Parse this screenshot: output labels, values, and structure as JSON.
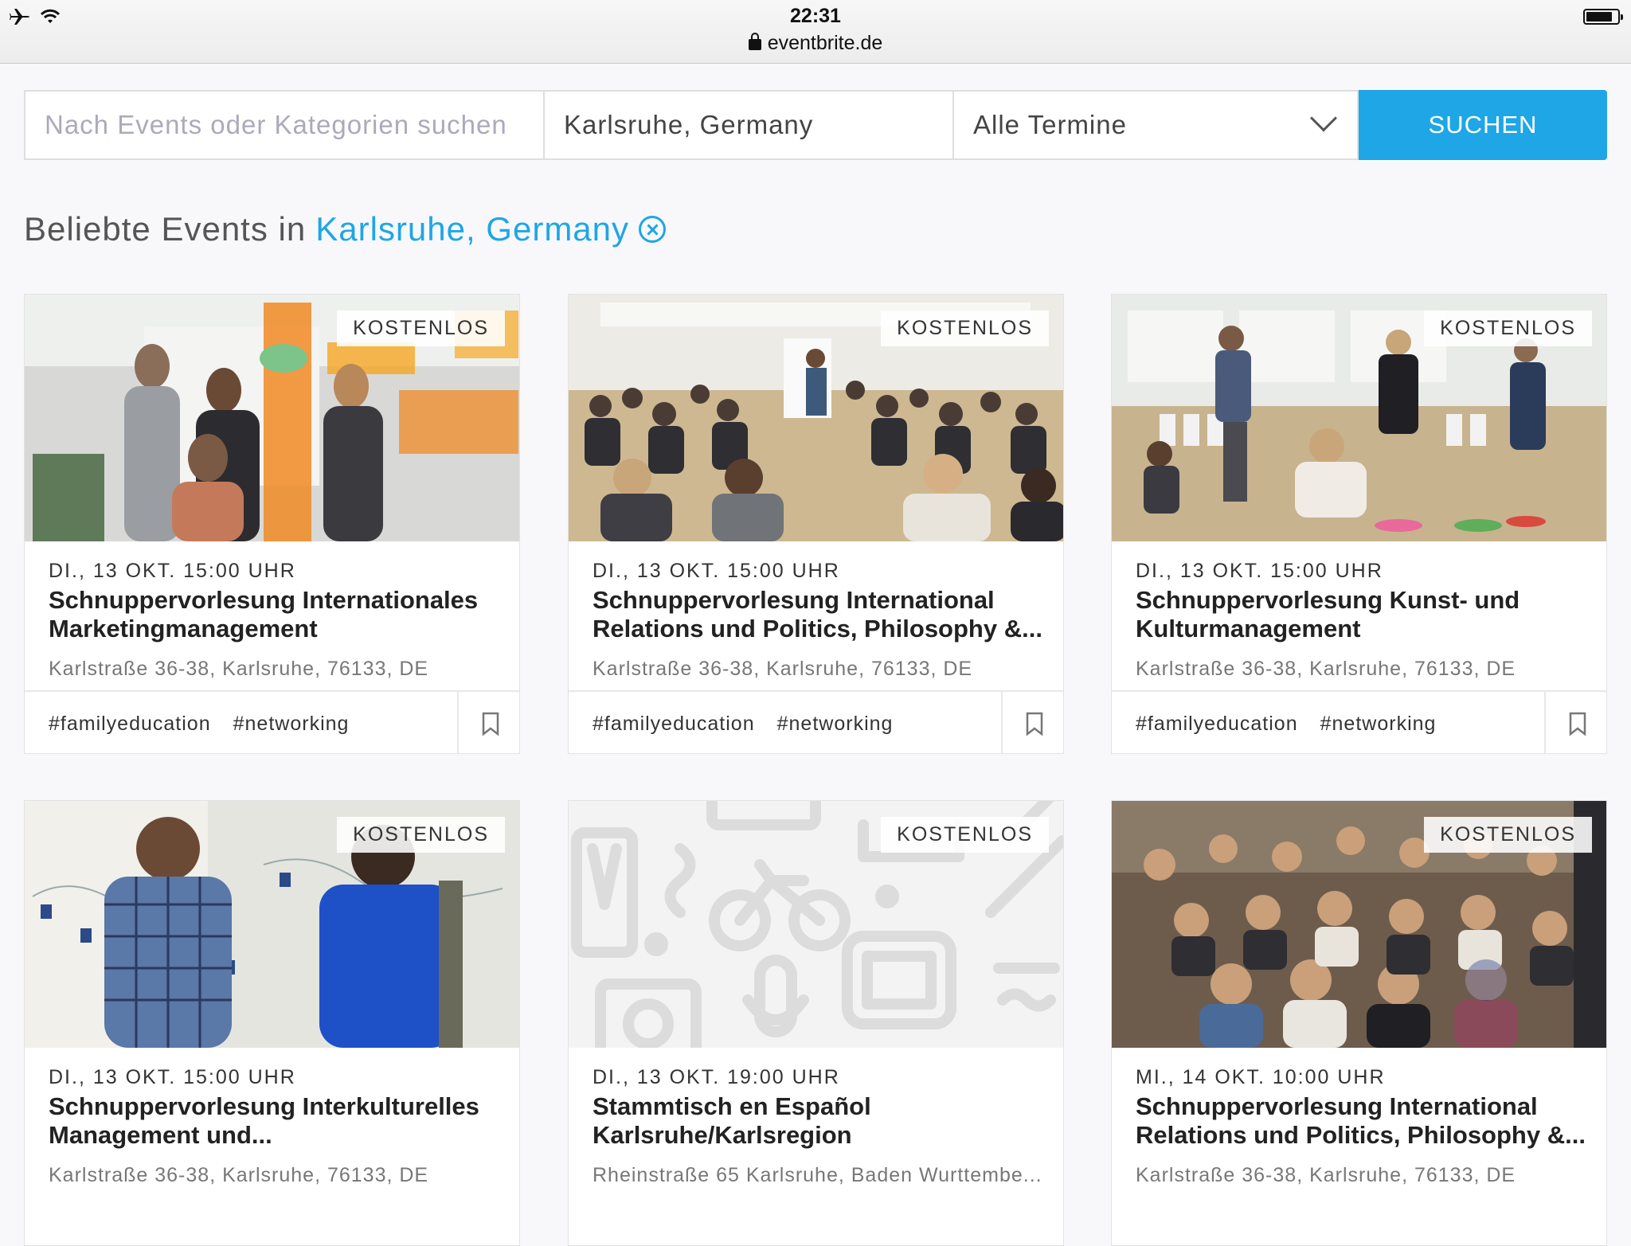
{
  "status": {
    "time": "22:31",
    "url": "eventbrite.de",
    "battery_level": 0.85
  },
  "search": {
    "query_placeholder": "Nach Events oder Kategorien suchen",
    "location": "Karlsruhe, Germany",
    "date": "Alle Termine",
    "button": "SUCHEN"
  },
  "heading": {
    "prefix": "Beliebte Events in",
    "city": "Karlsruhe, Germany"
  },
  "cards": [
    {
      "badge": "KOSTENLOS",
      "date": "DI., 13 OKT. 15:00 UHR",
      "title": "Schnuppervorlesung Internationales Marketingmanagement",
      "address": "Karlstraße 36-38, Karlsruhe, 76133, DE",
      "tags": [
        "#familyeducation",
        "#networking"
      ]
    },
    {
      "badge": "KOSTENLOS",
      "date": "DI., 13 OKT. 15:00 UHR",
      "title": "Schnuppervorlesung International Relations und Politics, Philosophy &...",
      "address": "Karlstraße 36-38, Karlsruhe, 76133, DE",
      "tags": [
        "#familyeducation",
        "#networking"
      ]
    },
    {
      "badge": "KOSTENLOS",
      "date": "DI., 13 OKT. 15:00 UHR",
      "title": "Schnuppervorlesung Kunst- und Kulturmanagement",
      "address": "Karlstraße 36-38, Karlsruhe, 76133, DE",
      "tags": [
        "#familyeducation",
        "#networking"
      ]
    },
    {
      "badge": "KOSTENLOS",
      "date": "DI., 13 OKT. 15:00 UHR",
      "title": "Schnuppervorlesung Interkulturelles Management und...",
      "address": "Karlstraße 36-38, Karlsruhe, 76133, DE",
      "tags": []
    },
    {
      "badge": "KOSTENLOS",
      "date": "DI., 13 OKT. 19:00 UHR",
      "title": "Stammtisch en Español Karlsruhe/Karlsregion",
      "address": "Rheinstraße 65 Karlsruhe, Baden Wurttembe...",
      "tags": []
    },
    {
      "badge": "KOSTENLOS",
      "date": "MI., 14 OKT. 10:00 UHR",
      "title": "Schnuppervorlesung International Relations und Politics, Philosophy &...",
      "address": "Karlstraße 36-38, Karlsruhe, 76133, DE",
      "tags": []
    }
  ]
}
